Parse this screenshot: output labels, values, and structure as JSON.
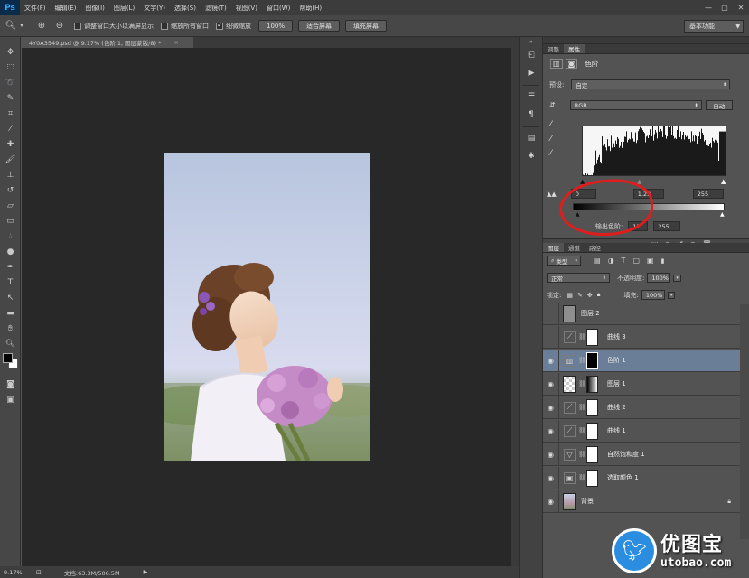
{
  "app": {
    "logo": "Ps"
  },
  "menu": [
    "文件(F)",
    "编辑(E)",
    "图像(I)",
    "图层(L)",
    "文字(Y)",
    "选择(S)",
    "滤镜(T)",
    "视图(V)",
    "窗口(W)",
    "帮助(H)"
  ],
  "window_controls": {
    "minimize": "—",
    "restore": "▢",
    "close": "✕"
  },
  "options_bar": {
    "tool_icon": "zoom-icon",
    "zoom_in": "⊕",
    "zoom_out": "⊖",
    "check_resize_windows": "调整窗口大小以满屏显示",
    "check_zoom_all": "缩放所有窗口",
    "check_scrubby": "细微缩放",
    "btn_100": "100%",
    "btn_fit": "适合屏幕",
    "btn_fill": "填充屏幕",
    "workspace": "基本功能"
  },
  "document": {
    "tab_title": "4Y0A3549.psd @ 9.17% (色阶 1, 图层蒙版/8) *",
    "close": "×"
  },
  "status_bar": {
    "zoom": "9.17%",
    "doc_info": "文档:63.3M/506.5M",
    "arrow": "▶"
  },
  "properties": {
    "tab_adjust": "调整",
    "tab_props": "属性",
    "title": "色阶",
    "preset_label": "预设:",
    "preset_value": "自定",
    "channel_value": "RGB",
    "auto_label": "自动",
    "input_black": "0",
    "input_mid": "1.23",
    "input_white": "255",
    "output_label": "输出色阶:",
    "output_black": "12",
    "output_white": "255",
    "accent_color": "#e11c1c"
  },
  "layers_panel": {
    "tab_layers": "图层",
    "tab_channels": "通道",
    "tab_paths": "路径",
    "filter_kind": "类型",
    "blend_mode": "正常",
    "opacity_label": "不透明度:",
    "opacity_value": "100%",
    "lock_label": "锁定:",
    "fill_label": "填充:",
    "fill_value": "100%",
    "layers": [
      {
        "name": "图层 2",
        "visible": false,
        "type": "gray",
        "selected": false
      },
      {
        "name": "曲线 3",
        "visible": false,
        "type": "curves",
        "selected": false
      },
      {
        "name": "色阶 1",
        "visible": true,
        "type": "levels",
        "selected": true
      },
      {
        "name": "图层 1",
        "visible": true,
        "type": "gradient",
        "selected": false
      },
      {
        "name": "曲线 2",
        "visible": true,
        "type": "curves",
        "selected": false
      },
      {
        "name": "曲线 1",
        "visible": true,
        "type": "curves",
        "selected": false
      },
      {
        "name": "自然饱和度 1",
        "visible": true,
        "type": "vibrance",
        "selected": false
      },
      {
        "name": "选取颜色 1",
        "visible": true,
        "type": "selective",
        "selected": false
      },
      {
        "name": "背景",
        "visible": true,
        "type": "photo",
        "selected": false
      }
    ]
  },
  "watermark": {
    "text": "优图宝",
    "url": "utobao.com"
  }
}
